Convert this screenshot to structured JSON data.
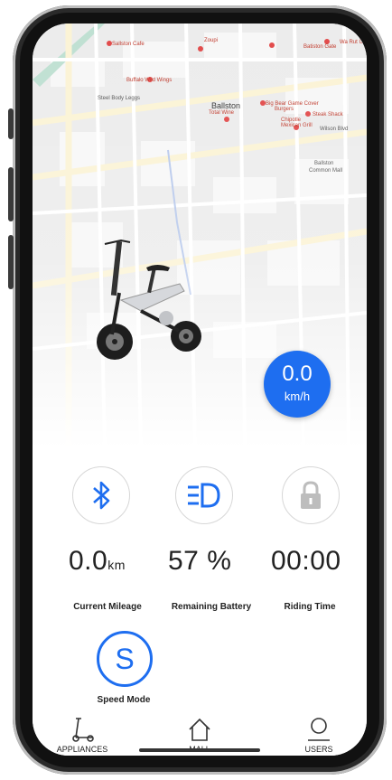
{
  "map": {
    "labels": [
      "Sallston Cafe",
      "Zoupi",
      "Wa Rut UZ",
      "Buffalo Wild Wings",
      "Batiston Gate",
      "Steel Body Leggs",
      "Ballston",
      "Big Bear Game Cover Burgers",
      "Steak Shack",
      "Chipotle Mexican Grill",
      "Total Wine",
      "Wilson Blvd",
      "Ballston Common Mall"
    ]
  },
  "speed": {
    "value": "0.0",
    "unit": "km/h"
  },
  "controls": [
    {
      "name": "bluetooth-button",
      "icon": "bluetooth-icon",
      "color": "#1e6ef0"
    },
    {
      "name": "headlight-button",
      "icon": "headlight-icon",
      "color": "#1e6ef0"
    },
    {
      "name": "lock-button",
      "icon": "lock-icon",
      "color": "#bdbdbd"
    }
  ],
  "stats": {
    "mileage": {
      "value": "0.0",
      "unit": "km",
      "label": "Current Mileage"
    },
    "battery": {
      "value": "57 %",
      "label": "Remaining Battery"
    },
    "riding_time": {
      "value": "00:00",
      "label": "Riding Time"
    }
  },
  "speed_mode": {
    "letter": "S",
    "label": "Speed Mode"
  },
  "tabs": [
    {
      "label": "APPLIANCES",
      "icon": "scooter-icon"
    },
    {
      "label": "MALL",
      "icon": "home-icon"
    },
    {
      "label": "USERS",
      "icon": "user-icon"
    }
  ],
  "colors": {
    "accent": "#1e6ef0",
    "disabled": "#bdbdbd"
  }
}
